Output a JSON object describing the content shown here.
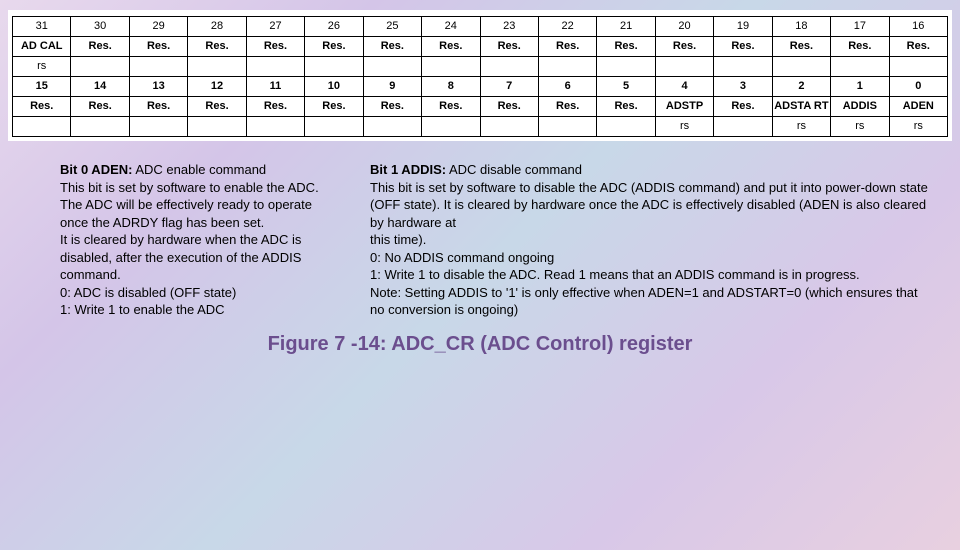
{
  "table": {
    "row1_bits": [
      "31",
      "30",
      "29",
      "28",
      "27",
      "26",
      "25",
      "24",
      "23",
      "22",
      "21",
      "20",
      "19",
      "18",
      "17",
      "16"
    ],
    "row2_labels": [
      "AD CAL",
      "Res.",
      "Res.",
      "Res.",
      "Res.",
      "Res.",
      "Res.",
      "Res.",
      "Res.",
      "Res.",
      "Res.",
      "Res.",
      "Res.",
      "Res.",
      "Res.",
      "Res."
    ],
    "row3_rw": [
      "rs",
      "",
      "",
      "",
      "",
      "",
      "",
      "",
      "",
      "",
      "",
      "",
      "",
      "",
      "",
      ""
    ],
    "row4_bits": [
      "15",
      "14",
      "13",
      "12",
      "11",
      "10",
      "9",
      "8",
      "7",
      "6",
      "5",
      "4",
      "3",
      "2",
      "1",
      "0"
    ],
    "row5_labels": [
      "Res.",
      "Res.",
      "Res.",
      "Res.",
      "Res.",
      "Res.",
      "Res.",
      "Res.",
      "Res.",
      "Res.",
      "Res.",
      "ADSTP",
      "Res.",
      "ADSTA RT",
      "ADDIS",
      "ADEN"
    ],
    "row6_rw": [
      "",
      "",
      "",
      "",
      "",
      "",
      "",
      "",
      "",
      "",
      "",
      "rs",
      "",
      "rs",
      "rs",
      "rs"
    ]
  },
  "bit0": {
    "title": "Bit 0 ADEN:",
    "title_rest": " ADC enable command",
    "body": "This bit is set by software to enable the ADC. The ADC will be effectively ready to operate once the ADRDY flag has been set.\nIt is cleared by hardware when the ADC is disabled, after the execution of the ADDIS command.\n0: ADC is disabled (OFF state)\n1: Write 1 to enable the ADC"
  },
  "bit1": {
    "title": "Bit 1 ADDIS:",
    "title_rest": " ADC disable command",
    "body": "This bit is set by software to disable the ADC (ADDIS command) and put it into power-down state (OFF state). It is cleared by hardware once the ADC is effectively disabled (ADEN is also cleared by hardware at\nthis time).\n0: No ADDIS command ongoing\n1: Write 1 to disable the ADC. Read 1 means that an ADDIS command is in progress.\nNote: Setting ADDIS to '1' is only effective when ADEN=1 and ADSTART=0 (which ensures that no conversion is ongoing)"
  },
  "caption": "Figure 7 -14: ADC_CR (ADC Control) register"
}
